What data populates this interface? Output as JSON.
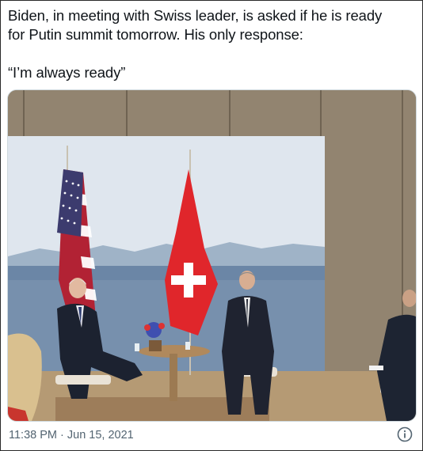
{
  "tweet": {
    "text": "Biden, in meeting with Swiss leader, is asked if he is ready\nfor Putin summit tomorrow. His only response:\n\n“I’m always ready”",
    "timestamp": "11:38 PM · Jun 15, 2021"
  },
  "media": {
    "scene": "photo",
    "flags": [
      "us-flag",
      "swiss-flag"
    ]
  },
  "icons": {
    "info": "info-icon"
  },
  "colors": {
    "text": "#0f1419",
    "muted": "#536471",
    "border": "#cfd9de"
  }
}
